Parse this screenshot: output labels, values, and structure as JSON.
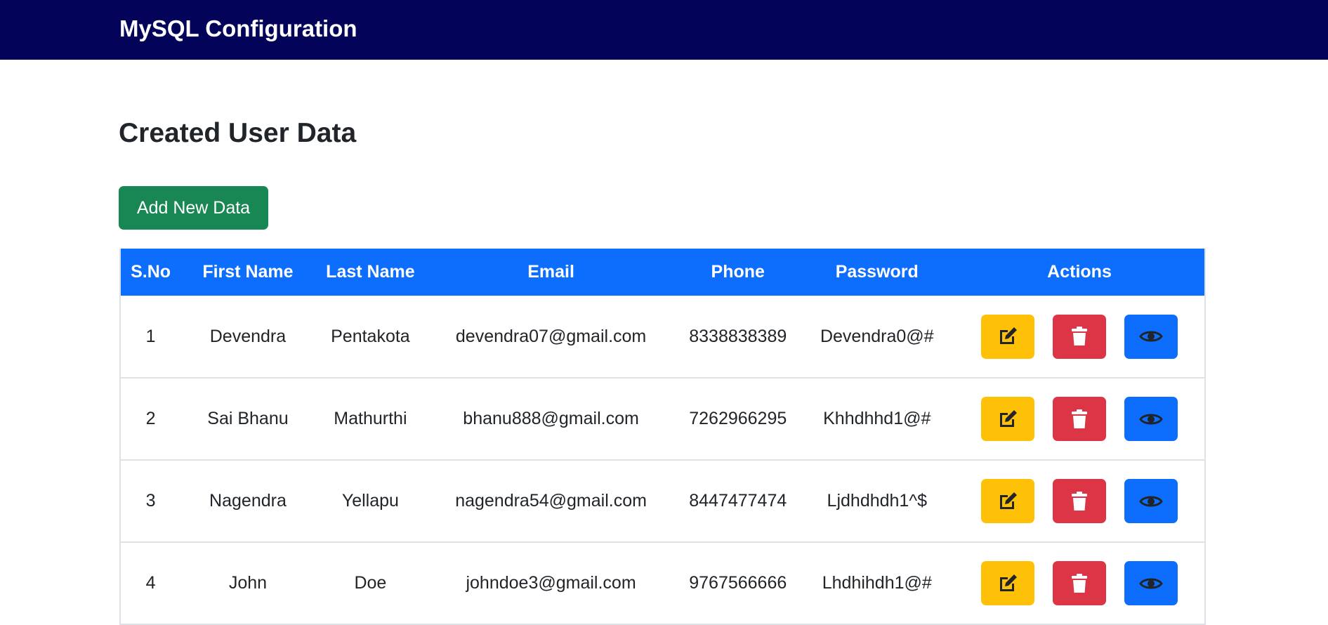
{
  "navbar": {
    "brand": "MySQL Configuration"
  },
  "page": {
    "title": "Created User Data",
    "add_button_label": "Add New Data"
  },
  "table": {
    "headers": [
      "S.No",
      "First Name",
      "Last Name",
      "Email",
      "Phone",
      "Password",
      "Actions"
    ],
    "rows": [
      {
        "sno": "1",
        "first_name": "Devendra",
        "last_name": "Pentakota",
        "email": "devendra07@gmail.com",
        "phone": "8338838389",
        "password": "Devendra0@#"
      },
      {
        "sno": "2",
        "first_name": "Sai Bhanu",
        "last_name": "Mathurthi",
        "email": "bhanu888@gmail.com",
        "phone": "7262966295",
        "password": "Khhdhhd1@#"
      },
      {
        "sno": "3",
        "first_name": "Nagendra",
        "last_name": "Yellapu",
        "email": "nagendra54@gmail.com",
        "phone": "8447477474",
        "password": "Ljdhdhdh1^$"
      },
      {
        "sno": "4",
        "first_name": "John",
        "last_name": "Doe",
        "email": "johndoe3@gmail.com",
        "phone": "9767566666",
        "password": "Lhdhihdh1@#"
      }
    ],
    "action_icons": {
      "edit": "edit-icon",
      "delete": "trash-icon",
      "view": "eye-icon"
    }
  },
  "colors": {
    "navbar_bg": "#03035a",
    "header_bg": "#0d6efd",
    "add_button": "#198754",
    "edit_button": "#ffc107",
    "delete_button": "#dc3545",
    "view_button": "#0d6efd"
  }
}
